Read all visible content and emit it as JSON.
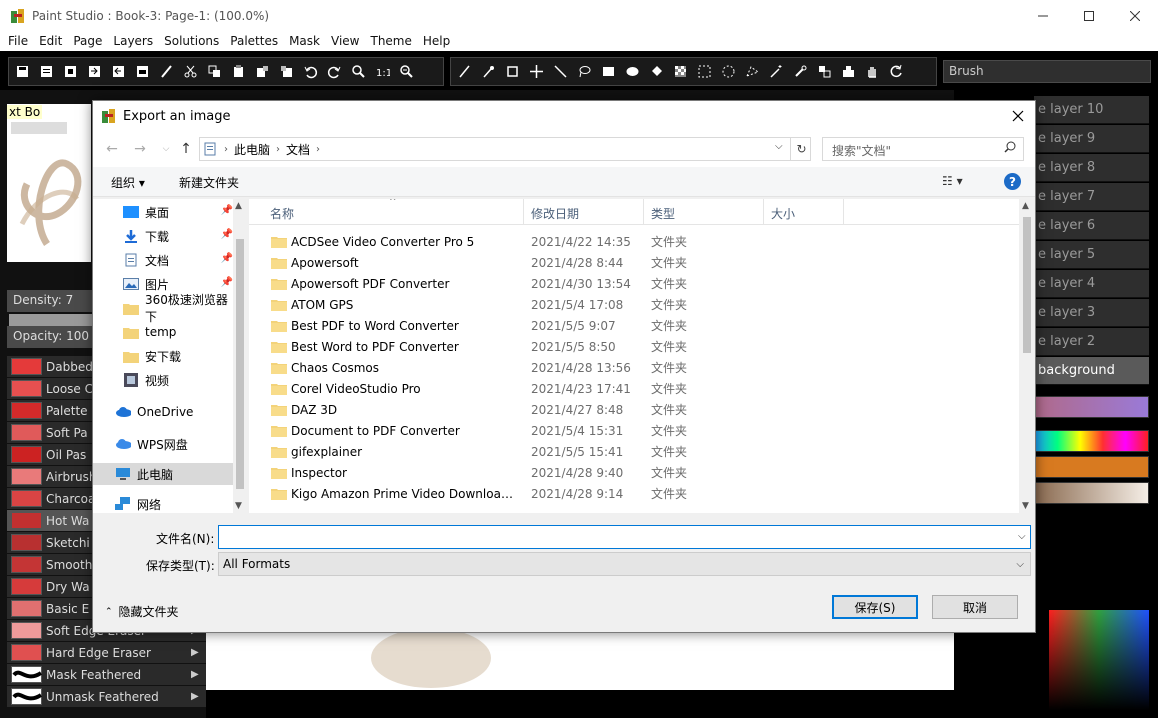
{
  "app": {
    "title": "Paint Studio : Book-3: Page-1:  (100.0%)",
    "menu": [
      "File",
      "Edit",
      "Page",
      "Layers",
      "Solutions",
      "Palettes",
      "Mask",
      "View",
      "Theme",
      "Help"
    ],
    "brush_field": "Brush"
  },
  "left_panel": {
    "preview_label": "xt Bo",
    "density": "Density: 7",
    "opacity": "Opacity: 100",
    "brushes": [
      {
        "label": "Dabbed",
        "color": "#e43a3a"
      },
      {
        "label": "Loose C",
        "color": "#e65050"
      },
      {
        "label": "Palette",
        "color": "#d42a2a"
      },
      {
        "label": "Soft Pa",
        "color": "#e05a5a"
      },
      {
        "label": "Oil Pas",
        "color": "#cc2222"
      },
      {
        "label": "Airbrush",
        "color": "#e97a7a"
      },
      {
        "label": "Charcoa",
        "color": "#d94444"
      },
      {
        "label": "Hot Wa",
        "color": "#c23030"
      },
      {
        "label": "Sketchi",
        "color": "#b83030"
      },
      {
        "label": "Smooth",
        "color": "#c43535"
      },
      {
        "label": "Dry Wa",
        "color": "#d63b3b"
      },
      {
        "label": "Basic E",
        "color": "#e07070"
      },
      {
        "label": "Soft Edge Eraser",
        "color": "#ee9a9a"
      },
      {
        "label": "Hard Edge Eraser",
        "color": "#e05050"
      },
      {
        "label": "Mask Feathered",
        "color": "#ffffff"
      },
      {
        "label": "Unmask Feathered",
        "color": "#ffffff"
      }
    ]
  },
  "right_panel": {
    "layers": [
      "e layer 10",
      "e layer 9",
      "e layer 8",
      "e layer 7",
      "e layer 6",
      "e layer 5",
      "e layer 4",
      "e layer 3",
      "e layer 2",
      "background"
    ]
  },
  "dialog": {
    "title": "Export an image",
    "breadcrumbs": [
      "此电脑",
      "文档"
    ],
    "search_placeholder": "搜索\"文档\"",
    "organize": "组织 ▾",
    "new_folder": "新建文件夹",
    "nav_items": [
      {
        "label": "桌面",
        "pinned": true
      },
      {
        "label": "下载",
        "pinned": true
      },
      {
        "label": "文档",
        "pinned": true
      },
      {
        "label": "图片",
        "pinned": true
      },
      {
        "label": "360极速浏览器下",
        "pinned": false
      },
      {
        "label": "temp",
        "pinned": false
      },
      {
        "label": "安下载",
        "pinned": false
      },
      {
        "label": "视频",
        "pinned": false
      },
      {
        "label": "OneDrive",
        "pinned": false
      },
      {
        "label": "WPS网盘",
        "pinned": false
      },
      {
        "label": "此电脑",
        "pinned": false
      },
      {
        "label": "网络",
        "pinned": false
      }
    ],
    "columns": [
      "名称",
      "修改日期",
      "类型",
      "大小"
    ],
    "files": [
      {
        "name": "ACDSee Video Converter Pro 5",
        "date": "2021/4/22 14:35",
        "type": "文件夹"
      },
      {
        "name": "Apowersoft",
        "date": "2021/4/28 8:44",
        "type": "文件夹"
      },
      {
        "name": "Apowersoft PDF Converter",
        "date": "2021/4/30 13:54",
        "type": "文件夹"
      },
      {
        "name": "ATOM GPS",
        "date": "2021/5/4 17:08",
        "type": "文件夹"
      },
      {
        "name": "Best PDF to Word Converter",
        "date": "2021/5/5 9:07",
        "type": "文件夹"
      },
      {
        "name": "Best Word to PDF Converter",
        "date": "2021/5/5 8:50",
        "type": "文件夹"
      },
      {
        "name": "Chaos Cosmos",
        "date": "2021/4/28 13:56",
        "type": "文件夹"
      },
      {
        "name": "Corel VideoStudio Pro",
        "date": "2021/4/23 17:41",
        "type": "文件夹"
      },
      {
        "name": "DAZ 3D",
        "date": "2021/4/27 8:48",
        "type": "文件夹"
      },
      {
        "name": "Document to PDF Converter",
        "date": "2021/5/4 15:31",
        "type": "文件夹"
      },
      {
        "name": "gifexplainer",
        "date": "2021/5/5 15:41",
        "type": "文件夹"
      },
      {
        "name": "Inspector",
        "date": "2021/4/28 9:40",
        "type": "文件夹"
      },
      {
        "name": "Kigo Amazon Prime Video Download...",
        "date": "2021/4/28 9:14",
        "type": "文件夹"
      }
    ],
    "filename_label": "文件名(N):",
    "filename_value": "",
    "filetype_label": "保存类型(T):",
    "filetype_value": "All Formats",
    "hide_folders": "隐藏文件夹",
    "save_button": "保存(S)",
    "cancel_button": "取消"
  }
}
